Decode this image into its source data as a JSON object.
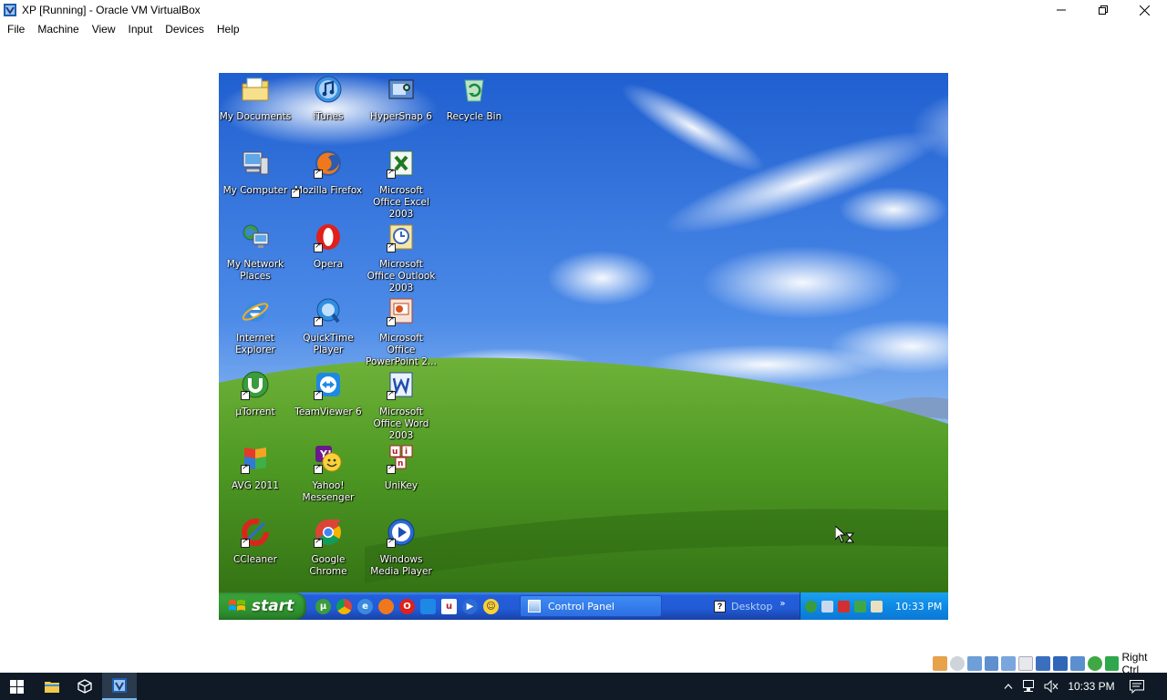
{
  "window": {
    "title": "XP [Running] - Oracle VM VirtualBox",
    "menu": [
      "File",
      "Machine",
      "View",
      "Input",
      "Devices",
      "Help"
    ]
  },
  "desktop": {
    "icons": [
      {
        "label": "My Documents",
        "icon": "my-documents-icon"
      },
      {
        "label": "iTunes",
        "icon": "itunes-icon"
      },
      {
        "label": "HyperSnap 6",
        "icon": "hypersnap-icon"
      },
      {
        "label": "Recycle Bin",
        "icon": "recycle-bin-icon"
      },
      {
        "label": "My Computer",
        "icon": "my-computer-icon"
      },
      {
        "label": "Mozilla Firefox",
        "icon": "firefox-icon"
      },
      {
        "label": "Microsoft Office Excel 2003",
        "icon": "excel-icon"
      },
      {
        "label": "My Network Places",
        "icon": "network-places-icon"
      },
      {
        "label": "Opera",
        "icon": "opera-icon"
      },
      {
        "label": "Microsoft Office Outlook 2003",
        "icon": "outlook-icon"
      },
      {
        "label": "Internet Explorer",
        "icon": "internet-explorer-icon"
      },
      {
        "label": "QuickTime Player",
        "icon": "quicktime-icon"
      },
      {
        "label": "Microsoft Office PowerPoint 2...",
        "icon": "powerpoint-icon"
      },
      {
        "label": "µTorrent",
        "icon": "utorrent-icon"
      },
      {
        "label": "TeamViewer 6",
        "icon": "teamviewer-icon"
      },
      {
        "label": "Microsoft Office Word 2003",
        "icon": "word-icon"
      },
      {
        "label": "AVG 2011",
        "icon": "avg-icon"
      },
      {
        "label": "Yahoo! Messenger",
        "icon": "yahoo-messenger-icon"
      },
      {
        "label": "UniKey",
        "icon": "unikey-icon"
      },
      {
        "label": "CCleaner",
        "icon": "ccleaner-icon"
      },
      {
        "label": "Google Chrome",
        "icon": "chrome-icon"
      },
      {
        "label": "Windows Media Player",
        "icon": "media-player-icon"
      }
    ]
  },
  "xp_taskbar": {
    "start_label": "start",
    "task": "Control Panel",
    "desktop_toolbar": "Desktop",
    "chevron": "»",
    "clock": "10:33 PM"
  },
  "statusbar": {
    "host_key": "Right Ctrl"
  },
  "host_taskbar": {
    "clock": "10:33 PM"
  }
}
